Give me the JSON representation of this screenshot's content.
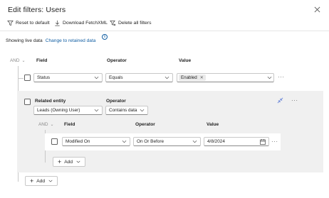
{
  "header": {
    "title": "Edit filters: Users"
  },
  "toolbar": {
    "reset_label": "Reset to default",
    "download_label": "Download FetchXML",
    "delete_label": "Delete all filters"
  },
  "status": {
    "prefix": "Showing live data",
    "link": "Change to retained data"
  },
  "top_group": {
    "and_label": "AND",
    "columns": {
      "field": "Field",
      "operator": "Operator",
      "value": "Value"
    },
    "row": {
      "field": "Status",
      "operator": "Equals",
      "value_tag": "Enabled"
    }
  },
  "related": {
    "entity_label": "Related entity",
    "operator_label": "Operator",
    "entity_value": "Leads (Owning User)",
    "operator_value": "Contains data",
    "inner": {
      "and_label": "AND",
      "columns": {
        "field": "Field",
        "operator": "Operator",
        "value": "Value"
      },
      "row": {
        "field": "Modified On",
        "operator": "On Or Before",
        "value": "4/8/2024"
      },
      "add_label": "Add"
    }
  },
  "bottom": {
    "add_label": "Add"
  },
  "colors": {
    "link": "#115ea3",
    "panel": "#f0f0f0",
    "accent_icon": "#5b7bd6"
  }
}
